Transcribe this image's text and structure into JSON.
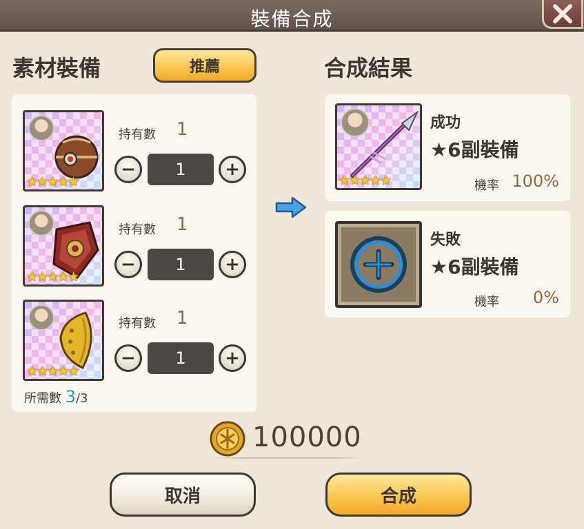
{
  "header": {
    "title": "裝備合成",
    "close_icon": "close-icon"
  },
  "materials": {
    "title": "素材裝備",
    "recommend_label": "推薦",
    "owned_label": "持有數",
    "items": [
      {
        "icon": "armored-sphere-icon",
        "stars": "★★★★★",
        "owned": "1",
        "quantity": "1"
      },
      {
        "icon": "crimson-shield-icon",
        "stars": "★★★★★",
        "owned": "1",
        "quantity": "1"
      },
      {
        "icon": "golden-leaf-shield-icon",
        "stars": "★★★★★",
        "owned": "1",
        "quantity": "1"
      }
    ],
    "minus_label": "−",
    "plus_label": "+",
    "required_label": "所需數",
    "required_current": "3",
    "required_total": "/3"
  },
  "results": {
    "title": "合成結果",
    "rate_label": "機率",
    "success": {
      "name": "成功",
      "equip": "★6副裝備",
      "rate": "100%",
      "stars": "★★★★★",
      "icon": "spear-icon"
    },
    "failure": {
      "name": "失敗",
      "equip": "★6副裝備",
      "rate": "0%",
      "icon": "plus-circle-icon"
    }
  },
  "cost": {
    "icon": "gold-coin-icon",
    "value": "100000"
  },
  "buttons": {
    "cancel": "取消",
    "synthesize": "合成"
  },
  "colors": {
    "accent_gold": "#f9c34a",
    "title_bar": "#6b5d55",
    "background": "#efe7d9",
    "value_brown": "#8e6a3c",
    "link_blue": "#2b8ed8"
  }
}
